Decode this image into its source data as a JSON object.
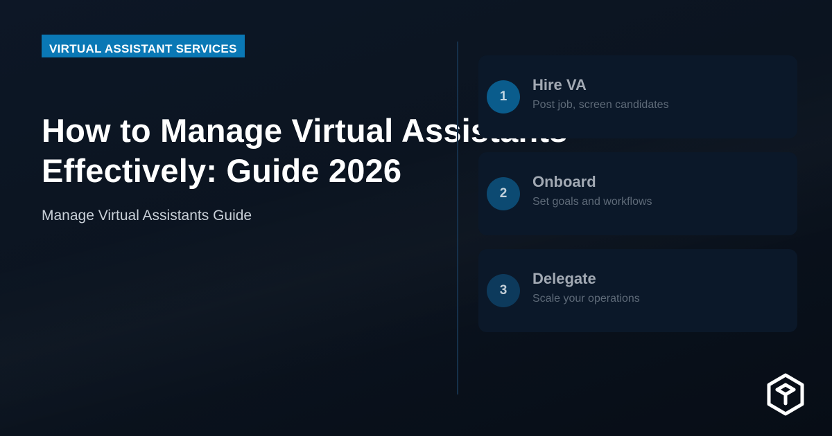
{
  "badge": {
    "label": "VIRTUAL ASSISTANT SERVICES"
  },
  "headline": {
    "line1": "How to Manage Virtual Assistants",
    "line2": "Effectively: Guide 2026"
  },
  "subtitle": "Manage Virtual Assistants Guide",
  "steps": [
    {
      "number": "1",
      "title": "Hire VA",
      "description": "Post job, screen candidates",
      "circle_color": "#0a5c8c"
    },
    {
      "number": "2",
      "title": "Onboard",
      "description": "Set goals and workflows",
      "circle_color": "#0c4a72"
    },
    {
      "number": "3",
      "title": "Delegate",
      "description": "Scale your operations",
      "circle_color": "#0d3a5c"
    }
  ],
  "logo": {
    "icon": "cube-hexagon-logo"
  },
  "colors": {
    "accent": "#0a78b5",
    "background": "#0b1420",
    "title": "#ffffff"
  }
}
